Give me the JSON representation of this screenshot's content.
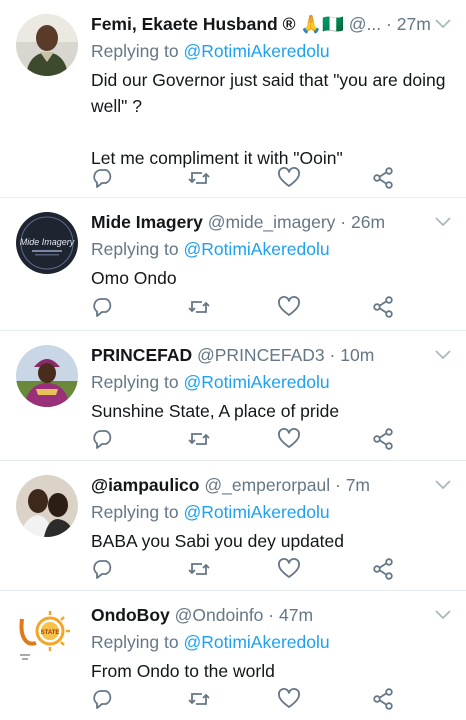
{
  "colors": {
    "text": "#14171a",
    "secondary": "#657786",
    "link": "#1da1f2",
    "divider": "#e6ecf0",
    "icon": "#657786"
  },
  "tweets": [
    {
      "display_name": "Femi, Ekaete Husband ® 🙏🇳🇬",
      "handle": "@...",
      "time": "27m",
      "reply_prefix": "Replying to",
      "reply_to": "@RotimiAkeredolu",
      "text": [
        "Did our Governor just said that \"you are doing well\" ?",
        "Let me compliment it with \"Ooin\""
      ],
      "avatar_icon": "user-photo"
    },
    {
      "display_name": "Mide Imagery",
      "handle": "@mide_imagery",
      "time": "26m",
      "reply_prefix": "Replying to",
      "reply_to": "@RotimiAkeredolu",
      "text": [
        "Omo Ondo"
      ],
      "avatar_icon": "brand-logo",
      "avatar_text": "Mide Imagery"
    },
    {
      "display_name": "PRINCEFAD",
      "handle": "@PRINCEFAD3",
      "time": "10m",
      "reply_prefix": "Replying to",
      "reply_to": "@RotimiAkeredolu",
      "text": [
        "Sunshine State, A place of pride"
      ],
      "avatar_icon": "user-photo"
    },
    {
      "display_name": "@iampaulico",
      "handle": "@_emperorpaul",
      "time": "7m",
      "reply_prefix": "Replying to",
      "reply_to": "@RotimiAkeredolu",
      "text": [
        "BABA you Sabi you dey updated"
      ],
      "avatar_icon": "user-photo"
    },
    {
      "display_name": "OndoBoy",
      "handle": "@Ondoinfo",
      "time": "47m",
      "reply_prefix": "Replying to",
      "reply_to": "@RotimiAkeredolu",
      "text": [
        "From Ondo to the world"
      ],
      "avatar_icon": "ondo-state-logo",
      "avatar_text": "STATE"
    }
  ]
}
